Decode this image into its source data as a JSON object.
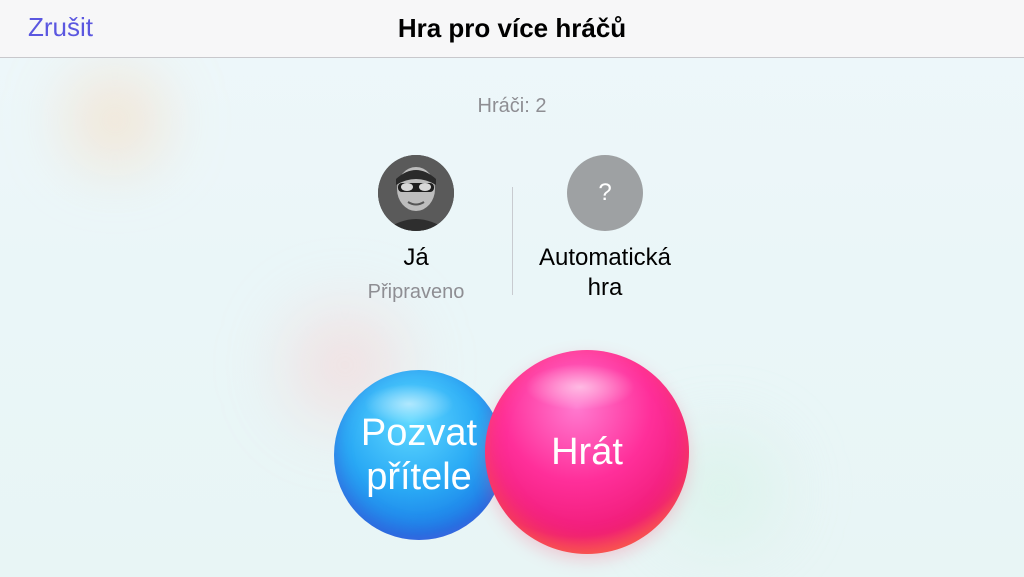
{
  "navbar": {
    "cancel_label": "Zrušit",
    "title": "Hra pro více hráčů"
  },
  "players_count": "Hráči: 2",
  "players": [
    {
      "name": "Já",
      "status": "Připraveno",
      "avatar": "user-photo"
    },
    {
      "name_line1": "Automatická",
      "name_line2": "hra",
      "avatar": "question-mark-icon",
      "avatar_glyph": "?"
    }
  ],
  "buttons": {
    "invite_line1": "Pozvat",
    "invite_line2": "přítele",
    "play_label": "Hrát"
  },
  "colors": {
    "accent": "#5b57e0",
    "invite_bubble": "#2aaaf5",
    "play_bubble": "#ff2f9a"
  }
}
